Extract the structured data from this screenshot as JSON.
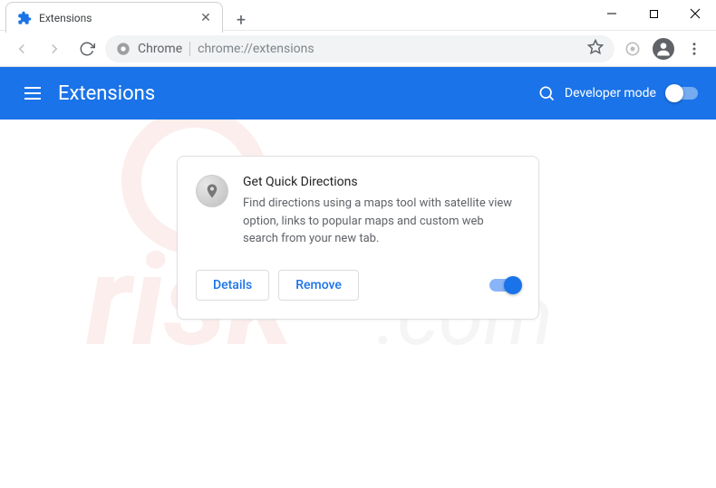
{
  "window": {
    "tab_title": "Extensions"
  },
  "addressbar": {
    "origin_label": "Chrome",
    "url": "chrome://extensions"
  },
  "toolbar": {
    "title": "Extensions",
    "developer_mode_label": "Developer mode",
    "developer_mode_on": false
  },
  "extension": {
    "name": "Get Quick Directions",
    "description": "Find directions using a maps tool with satellite view option, links to popular maps and custom web search from your new tab.",
    "details_label": "Details",
    "remove_label": "Remove",
    "enabled": true
  },
  "colors": {
    "accent": "#1a73e8"
  }
}
